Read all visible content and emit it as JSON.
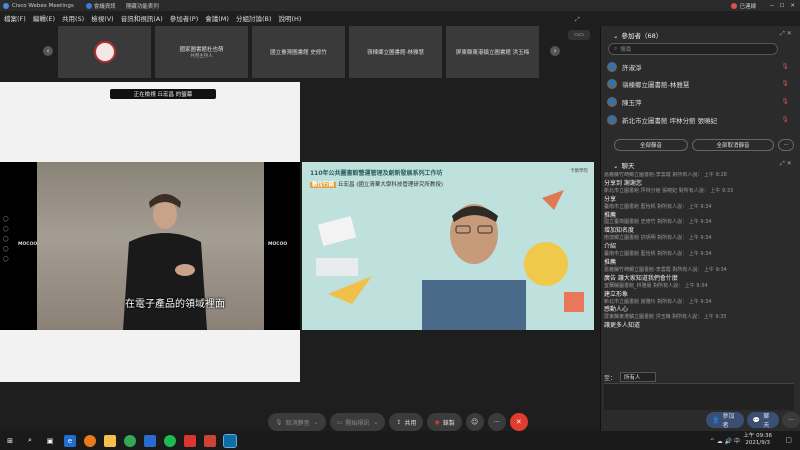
{
  "window": {
    "title": "Cisco Webex Meetings",
    "info_tab": "會議資訊",
    "hide_menu": "隱藏功能表列",
    "user": "已連線"
  },
  "menu": [
    "檔案(F)",
    "編輯(E)",
    "共用(S)",
    "檢視(V)",
    "音訊和視訊(A)",
    "參加者(P)",
    "會議(M)",
    "分組討論(B)",
    "說明(H)"
  ],
  "thumbnails": [
    {
      "label": "",
      "sub": ""
    },
    {
      "label": "國家圖書館杜也萌",
      "sub": "共用主持人"
    },
    {
      "label": "國立臺灣圖書館 史修竹",
      "sub": ""
    },
    {
      "label": "嶺棟鄉立圖書館-林雅慧",
      "sub": ""
    },
    {
      "label": "屏東縣東港鎮立圖書館 洪玉梅",
      "sub": ""
    }
  ],
  "stage": {
    "share_banner": "正在檢視 丘宏昌 的螢幕",
    "video_caption": "在電子產品的領域裡面",
    "moc_left": "MOCOO",
    "moc_right": "MOCOO",
    "slide_title": "110年公共圖書館營運管理及創新發展系列工作坊",
    "speaker_badge": "數位行銷",
    "speaker_name": "丘宏昌 (國立清華大學科技管理研究所教授)",
    "slide_logo": "卡爾學院"
  },
  "left_side_icons": [
    "◯",
    "◯",
    "◯",
    "◯",
    "◯"
  ],
  "controls": {
    "mute": "取消靜音",
    "video": "開始視訊",
    "share": "共用",
    "record": "錄製",
    "emoji": "☺",
    "more": "···",
    "end": "✕"
  },
  "participants": {
    "header": "參加者（68）",
    "search_placeholder": "搜尋",
    "items": [
      {
        "name": "許淑淨"
      },
      {
        "name": "嶺棟鄉立圖書館-林雅慧"
      },
      {
        "name": "陳玉萍"
      },
      {
        "name": "新北市立圖書館 坪林分館 張曉妃"
      }
    ],
    "mute_all": "全部靜音",
    "unmute_all": "全部取消靜音",
    "more": "···"
  },
  "chat": {
    "header": "聊天",
    "log": [
      {
        "type": "meta",
        "text": "嘉義縣竹崎鄉立圖書館-李雲霞 對所有人說：    上午 9:28"
      },
      {
        "type": "msg",
        "text": "分享到 謝謝您"
      },
      {
        "type": "meta",
        "text": "新北市立圖書館 坪林分館 張曉妃 對所有人說：    上午 9:33"
      },
      {
        "type": "msg",
        "text": "分享"
      },
      {
        "type": "meta",
        "text": "臺南市立圖書館 藍怡帆 對所有人說：    上午 9:34"
      },
      {
        "type": "msg",
        "text": "推薦"
      },
      {
        "type": "meta",
        "text": "國立臺灣圖書館 史修竹 對所有人說：    上午 9:34"
      },
      {
        "type": "msg",
        "text": "增加知名度"
      },
      {
        "type": "meta",
        "text": "南澳鄉立圖書館 許玥明 對所有人說：    上午 9:34"
      },
      {
        "type": "msg",
        "text": "介紹"
      },
      {
        "type": "meta",
        "text": "臺南市立圖書館 藍怡帆 對所有人說：    上午 9:34"
      },
      {
        "type": "msg",
        "text": "推薦"
      },
      {
        "type": "meta",
        "text": "嘉義縣竹崎鄉立圖書館-李雲霞 對所有人說：    上午 9:34"
      },
      {
        "type": "msg",
        "text": "廣告  讓大家知道我們會什麼"
      },
      {
        "type": "meta",
        "text": "宜蘭縣圖書館_林雅晨 對所有人說：    上午 9:34"
      },
      {
        "type": "msg",
        "text": "建立形象"
      },
      {
        "type": "meta",
        "text": "新北市立圖書館 謝雅玲 對所有人說：    上午 9:34"
      },
      {
        "type": "msg",
        "text": "感動人心"
      },
      {
        "type": "meta",
        "text": "屏東縣東港鎮立圖書館 洪玉梅 對所有人說：    上午 9:35"
      },
      {
        "type": "msg",
        "text": "讓更多人知道"
      }
    ],
    "to_label": "至：",
    "to_value": "所有人",
    "tab_participants": "參加者",
    "tab_chat": "聊天"
  },
  "taskbar": {
    "time": "上午 09:36",
    "date": "2021/9/3"
  }
}
